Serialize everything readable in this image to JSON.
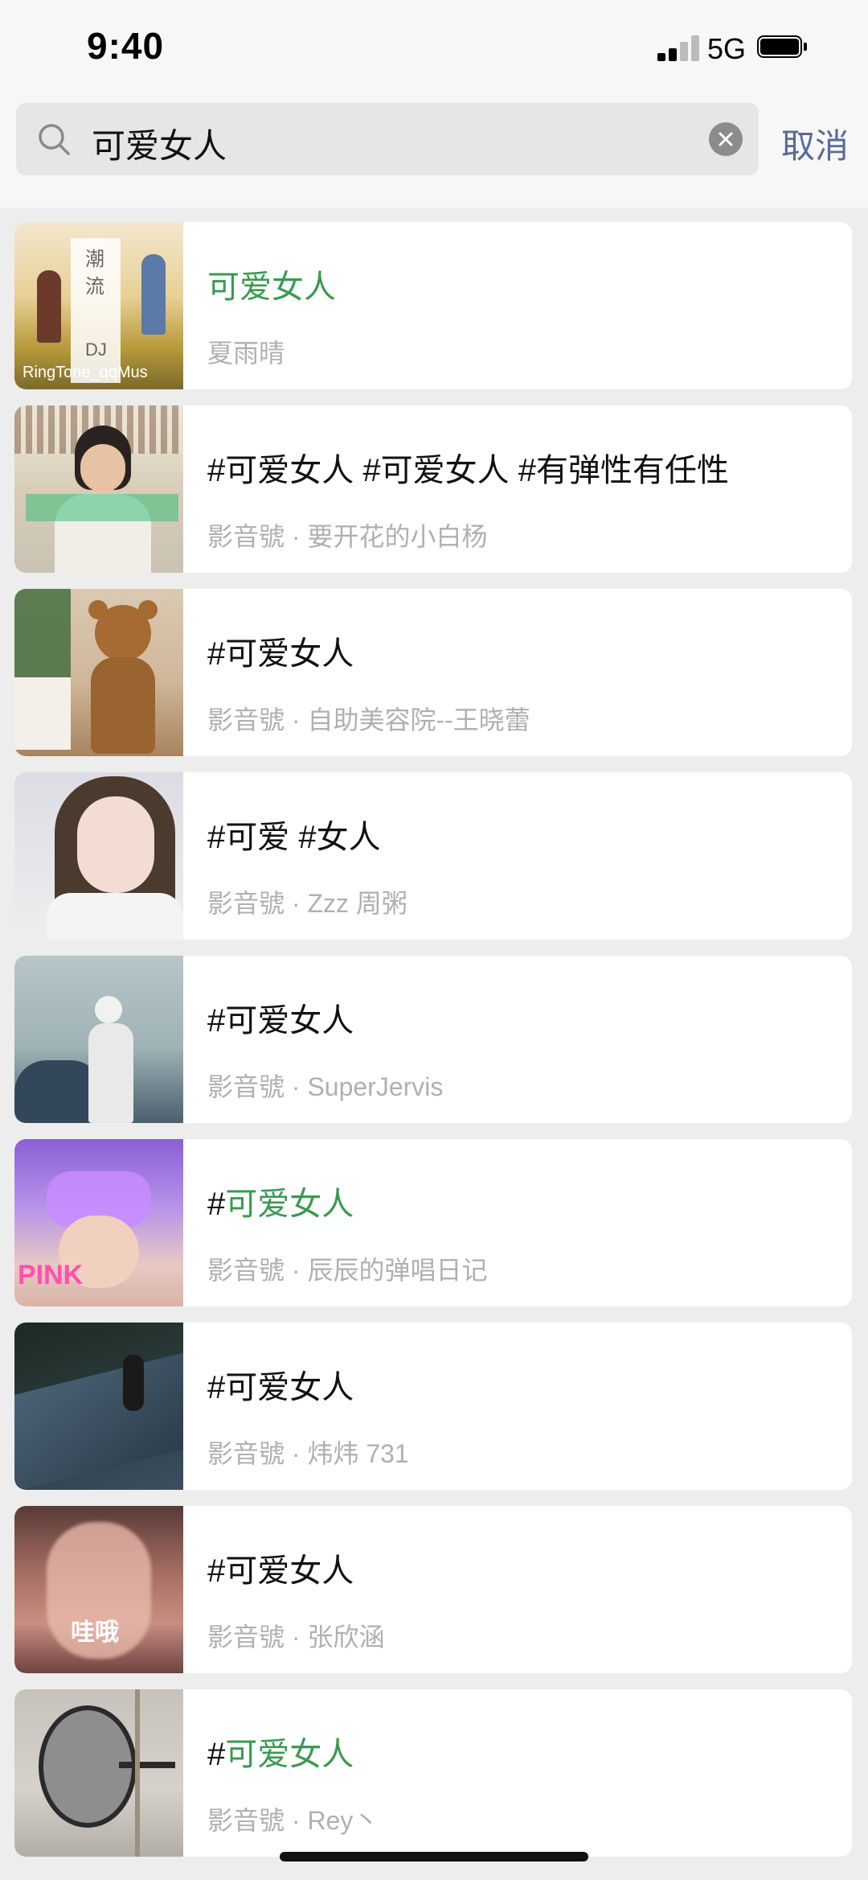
{
  "status_bar": {
    "time": "9:40",
    "network": "5G"
  },
  "search": {
    "query": "可爱女人",
    "cancel_label": "取消"
  },
  "colors": {
    "highlight": "#3a9a51",
    "link": "#576b95"
  },
  "results": [
    {
      "title_prefix": "",
      "title_highlight": "可爱女人",
      "title_plain": "",
      "subtitle": "夏雨晴",
      "thumb_text": "RingTone_qqMus",
      "thumb_side_text": "潮流",
      "thumb_dj_text": "DJ"
    },
    {
      "title_prefix": "",
      "title_highlight": "",
      "title_plain": "#可爱女人  #可爱女人  #有弹性有任性",
      "subtitle": "影音號 · 要开花的小白杨"
    },
    {
      "title_prefix": "",
      "title_highlight": "",
      "title_plain": "#可爱女人",
      "subtitle": "影音號 · 自助美容院--王晓蕾"
    },
    {
      "title_prefix": "",
      "title_highlight": "",
      "title_plain": "#可爱 #女人",
      "subtitle": "影音號 · Zzz 周粥"
    },
    {
      "title_prefix": "",
      "title_highlight": "",
      "title_plain": "#可爱女人",
      "subtitle": "影音號 · SuperJervis"
    },
    {
      "title_prefix": "#",
      "title_highlight": "可爱女人",
      "title_plain": "",
      "subtitle": "影音號 · 辰辰的弹唱日记",
      "thumb_text": "PINK"
    },
    {
      "title_prefix": "",
      "title_highlight": "",
      "title_plain": "#可爱女人",
      "subtitle": "影音號 · 炜炜 731"
    },
    {
      "title_prefix": "",
      "title_highlight": "",
      "title_plain": "#可爱女人",
      "subtitle": "影音號 · 张欣涵",
      "thumb_text": "哇哦"
    },
    {
      "title_prefix": "#",
      "title_highlight": "可爱女人",
      "title_plain": "",
      "subtitle": "影音號 · Rey丶"
    }
  ]
}
